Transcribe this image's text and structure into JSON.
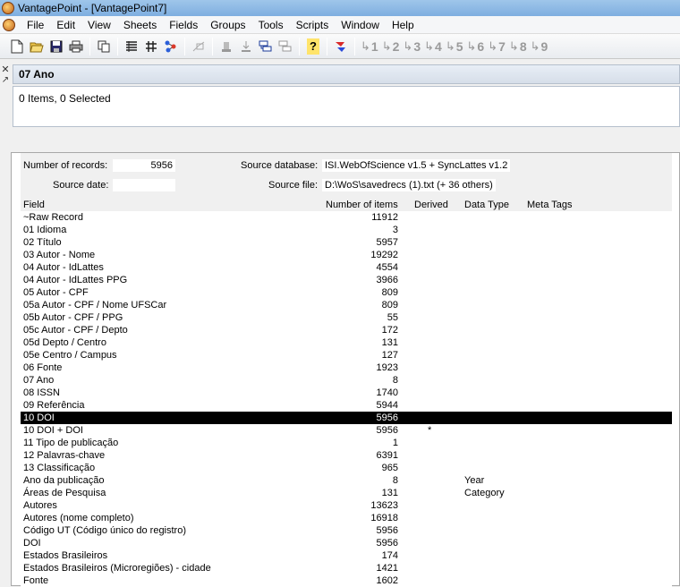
{
  "window": {
    "title": "VantagePoint - [VantagePoint7]"
  },
  "menu": [
    "File",
    "Edit",
    "View",
    "Sheets",
    "Fields",
    "Groups",
    "Tools",
    "Scripts",
    "Window",
    "Help"
  ],
  "toolbar": {
    "icons": [
      "new-icon",
      "open-icon",
      "save-icon",
      "print-icon",
      "copy-icon",
      "list-icon",
      "matrix-icon",
      "map-icon",
      "disabled-icon",
      "sort-icon",
      "sort-down-icon",
      "group-icon",
      "group-alt-icon",
      "help-icon",
      "marker-icon"
    ],
    "help_glyph": "?",
    "numbered": [
      "1",
      "2",
      "3",
      "4",
      "5",
      "6",
      "7",
      "8",
      "9"
    ]
  },
  "document": {
    "title": "07 Ano",
    "status": "0 Items, 0 Selected"
  },
  "summary": {
    "records_label": "Number of records:",
    "records_value": "5956",
    "source_db_label": "Source database:",
    "source_db_value": "ISI.WebOfScience v1.5 + SyncLattes v1.2",
    "source_date_label": "Source date:",
    "source_date_value": "",
    "source_file_label": "Source file:",
    "source_file_value": "D:\\WoS\\savedrecs (1).txt (+ 36 others)",
    "columns": {
      "field": "Field",
      "items": "Number of items",
      "derived": "Derived",
      "type": "Data Type",
      "meta": "Meta Tags"
    },
    "rows": [
      {
        "field": "~Raw Record",
        "items": "11912",
        "derived": "",
        "type": "",
        "meta": ""
      },
      {
        "field": "01 Idioma",
        "items": "3",
        "derived": "",
        "type": "",
        "meta": ""
      },
      {
        "field": "02 Título",
        "items": "5957",
        "derived": "",
        "type": "",
        "meta": ""
      },
      {
        "field": "03 Autor - Nome",
        "items": "19292",
        "derived": "",
        "type": "",
        "meta": ""
      },
      {
        "field": "04 Autor - IdLattes",
        "items": "4554",
        "derived": "",
        "type": "",
        "meta": ""
      },
      {
        "field": "04 Autor - IdLattes PPG",
        "items": "3966",
        "derived": "",
        "type": "",
        "meta": ""
      },
      {
        "field": "05 Autor - CPF",
        "items": "809",
        "derived": "",
        "type": "",
        "meta": ""
      },
      {
        "field": "05a Autor - CPF / Nome UFSCar",
        "items": "809",
        "derived": "",
        "type": "",
        "meta": ""
      },
      {
        "field": "05b Autor - CPF / PPG",
        "items": "55",
        "derived": "",
        "type": "",
        "meta": ""
      },
      {
        "field": "05c Autor - CPF / Depto",
        "items": "172",
        "derived": "",
        "type": "",
        "meta": ""
      },
      {
        "field": "05d Depto / Centro",
        "items": "131",
        "derived": "",
        "type": "",
        "meta": ""
      },
      {
        "field": "05e Centro / Campus",
        "items": "127",
        "derived": "",
        "type": "",
        "meta": ""
      },
      {
        "field": "06 Fonte",
        "items": "1923",
        "derived": "",
        "type": "",
        "meta": ""
      },
      {
        "field": "07 Ano",
        "items": "8",
        "derived": "",
        "type": "",
        "meta": ""
      },
      {
        "field": "08 ISSN",
        "items": "1740",
        "derived": "",
        "type": "",
        "meta": ""
      },
      {
        "field": "09 Referência",
        "items": "5944",
        "derived": "",
        "type": "",
        "meta": ""
      },
      {
        "field": "10 DOI",
        "items": "5956",
        "derived": "",
        "type": "",
        "meta": "",
        "selected": true
      },
      {
        "field": "10 DOI + DOI",
        "items": "5956",
        "derived": "*",
        "type": "",
        "meta": ""
      },
      {
        "field": "11 Tipo de publicação",
        "items": "1",
        "derived": "",
        "type": "",
        "meta": ""
      },
      {
        "field": "12 Palavras-chave",
        "items": "6391",
        "derived": "",
        "type": "",
        "meta": ""
      },
      {
        "field": "13 Classificação",
        "items": "965",
        "derived": "",
        "type": "",
        "meta": ""
      },
      {
        "field": "Ano da publicação",
        "items": "8",
        "derived": "",
        "type": "Year",
        "meta": ""
      },
      {
        "field": "Áreas de Pesquisa",
        "items": "131",
        "derived": "",
        "type": "Category",
        "meta": ""
      },
      {
        "field": "Autores",
        "items": "13623",
        "derived": "",
        "type": "",
        "meta": ""
      },
      {
        "field": "Autores (nome completo)",
        "items": "16918",
        "derived": "",
        "type": "",
        "meta": ""
      },
      {
        "field": "Código UT (Código único do registro)",
        "items": "5956",
        "derived": "",
        "type": "",
        "meta": ""
      },
      {
        "field": "DOI",
        "items": "5956",
        "derived": "",
        "type": "",
        "meta": ""
      },
      {
        "field": "Estados Brasileiros",
        "items": "174",
        "derived": "",
        "type": "",
        "meta": ""
      },
      {
        "field": "Estados Brasileiros (Microregiões) - cidade",
        "items": "1421",
        "derived": "",
        "type": "",
        "meta": ""
      },
      {
        "field": "Fonte",
        "items": "1602",
        "derived": "",
        "type": "",
        "meta": ""
      }
    ]
  }
}
